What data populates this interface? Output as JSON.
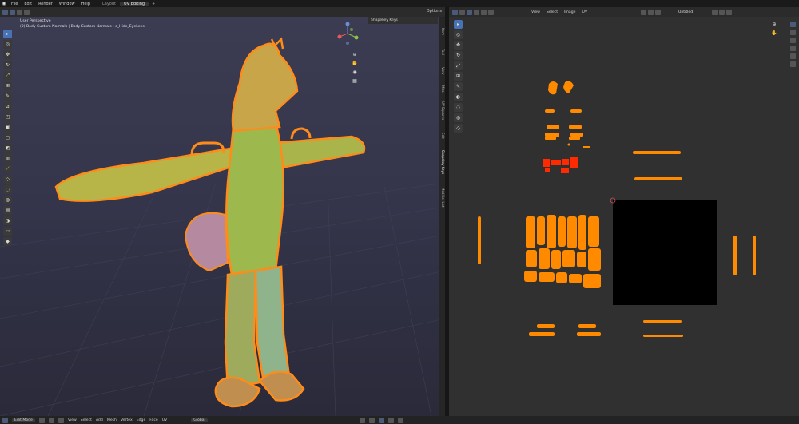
{
  "topbar": {
    "menus": [
      "File",
      "Edit",
      "Render",
      "Window",
      "Help"
    ],
    "workspaces": [
      {
        "label": "Layout",
        "active": false
      },
      {
        "label": "UV Editing",
        "active": true
      }
    ],
    "add_label": "+"
  },
  "viewport": {
    "options_label": "Options",
    "perspective": "User Perspective",
    "object_info": "(0) Body Custom Normals | Body Custom Normals : c_Hide_EyeLens",
    "shape_keys_panel": "Shapekey Keys",
    "side_tabs": [
      "Item",
      "Tool",
      "View",
      "Miro",
      "UV Squares",
      "Edit",
      "Shapekey Keys",
      "Modifier List"
    ]
  },
  "uv_editor": {
    "menus": [
      "View",
      "Select",
      "Image",
      "UV"
    ],
    "image_name": "Untitled"
  },
  "status": {
    "mode": "Edit Mode",
    "menus": [
      "View",
      "Select",
      "Add",
      "Mesh",
      "Vertex",
      "Edge",
      "Face",
      "UV"
    ],
    "orientation": "Global"
  },
  "colors": {
    "accent": "#4772b3",
    "mesh_orange": "#ff8c1a",
    "uv_orange": "#ff8a00",
    "selected_red": "#ff2a00"
  }
}
